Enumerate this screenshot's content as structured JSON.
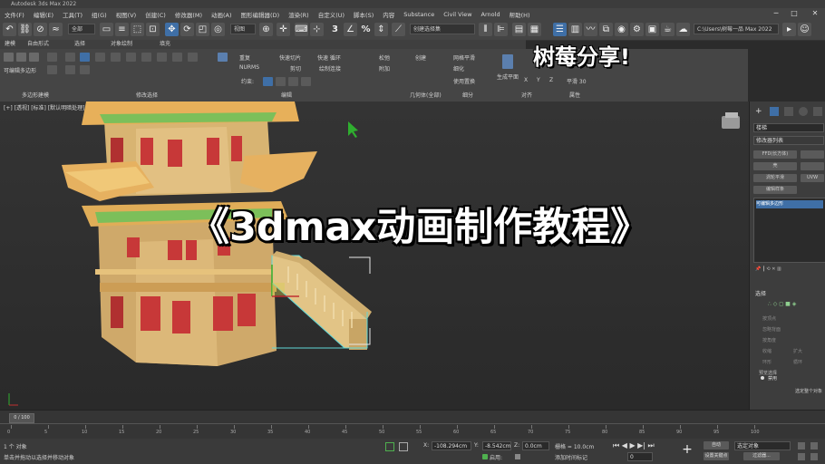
{
  "app": {
    "title": "Autodesk 3ds Max 2022"
  },
  "menu": [
    "文件(F)",
    "编辑(E)",
    "工具(T)",
    "组(G)",
    "视图(V)",
    "创建(C)",
    "修改器(M)",
    "动画(A)",
    "图形编辑器(D)",
    "渲染(R)",
    "自定义(U)",
    "脚本(S)",
    "内容",
    "Substance",
    "Civil View",
    "Arnold",
    "帮助(H)"
  ],
  "window_controls": {
    "minimize": "─",
    "maximize": "□",
    "close": "✕"
  },
  "toolbar": {
    "set_dropdown": "全部",
    "view_dropdown": "视图",
    "selection_set": "创建选择集",
    "path": "C:\\Users\\树莓一品 Max 2022",
    "labels": {
      "three": "3",
      "percent": "%"
    }
  },
  "ribbon": {
    "tabs": [
      "建模",
      "自由形式",
      "选择",
      "对象绘制",
      "填充"
    ],
    "groups": {
      "poly_modeling": "多边形建模",
      "modify_selection": "修改选择",
      "edit": "编辑",
      "geometry": "几何体(全部)",
      "subdivide": "细分",
      "align": "对齐",
      "properties": "属性"
    },
    "items": {
      "editable_poly": "可编辑多边形",
      "repeat": "重复",
      "quick_slice": "快速切片",
      "quick_loop": "快速 循环",
      "nurms": "NURMS",
      "cut": "剪切",
      "paint_connect": "绘制连接",
      "constrain": "约束:",
      "collapse": "松弛",
      "create": "创建",
      "attach": "附加",
      "mesh_smooth": "网格平滑",
      "tessellate": "细化",
      "use_displacement": "使用置换",
      "generate_plane": "生成平面",
      "x": "X",
      "y": "Y",
      "z": "Z",
      "plane30": "平滑 30"
    }
  },
  "watermark": "树莓分享!",
  "viewport": {
    "label": "[+] [透视] [标准] [默认明暗处理]",
    "banner": "《3dmax动画制作教程》",
    "colors": {
      "wall": "#d4b06a",
      "roof": "#e2ad56",
      "green": "#7fbf5a",
      "window": "#c83a3a",
      "dark": "#262626"
    }
  },
  "command_panel": {
    "object_name": "楼梯",
    "modifier_list": "修改器列表",
    "buttons": [
      "FFD(长方体)",
      "",
      "壳",
      "",
      "涡轮平滑",
      "UVW",
      "编辑样条",
      ""
    ],
    "stack_item": "可编辑多边形",
    "section_select": "选择",
    "sub_options": [
      "按顶点",
      "忽略背面",
      "按角度",
      "收缩",
      "扩大",
      "环形",
      "循环"
    ],
    "preview_label": "预览选择",
    "disabled": "禁用",
    "selected_count": "选定整个对象"
  },
  "timeline": {
    "frame": "0 / 100",
    "ticks": [
      "0",
      "5",
      "10",
      "15",
      "20",
      "25",
      "30",
      "35",
      "40",
      "45",
      "50",
      "55",
      "60",
      "65",
      "70",
      "75",
      "80",
      "85",
      "90",
      "95",
      "100"
    ]
  },
  "status": {
    "selected": "1 个 对象",
    "hint": "单击并拖动以选择并移动对象",
    "x_label": "X:",
    "x_value": "-108.294cm",
    "y_label": "Y:",
    "y_value": "-8.542cm",
    "z_label": "Z:",
    "z_value": "0.0cm",
    "grid": "栅格 = 10.0cm",
    "enable": "启用:",
    "add_time_tag": "添加时间标记",
    "auto_key": "自动",
    "set_key": "设置关键点",
    "selected_obj": "选定对象",
    "key_filters": "过滤器...",
    "frame_value": "0"
  }
}
